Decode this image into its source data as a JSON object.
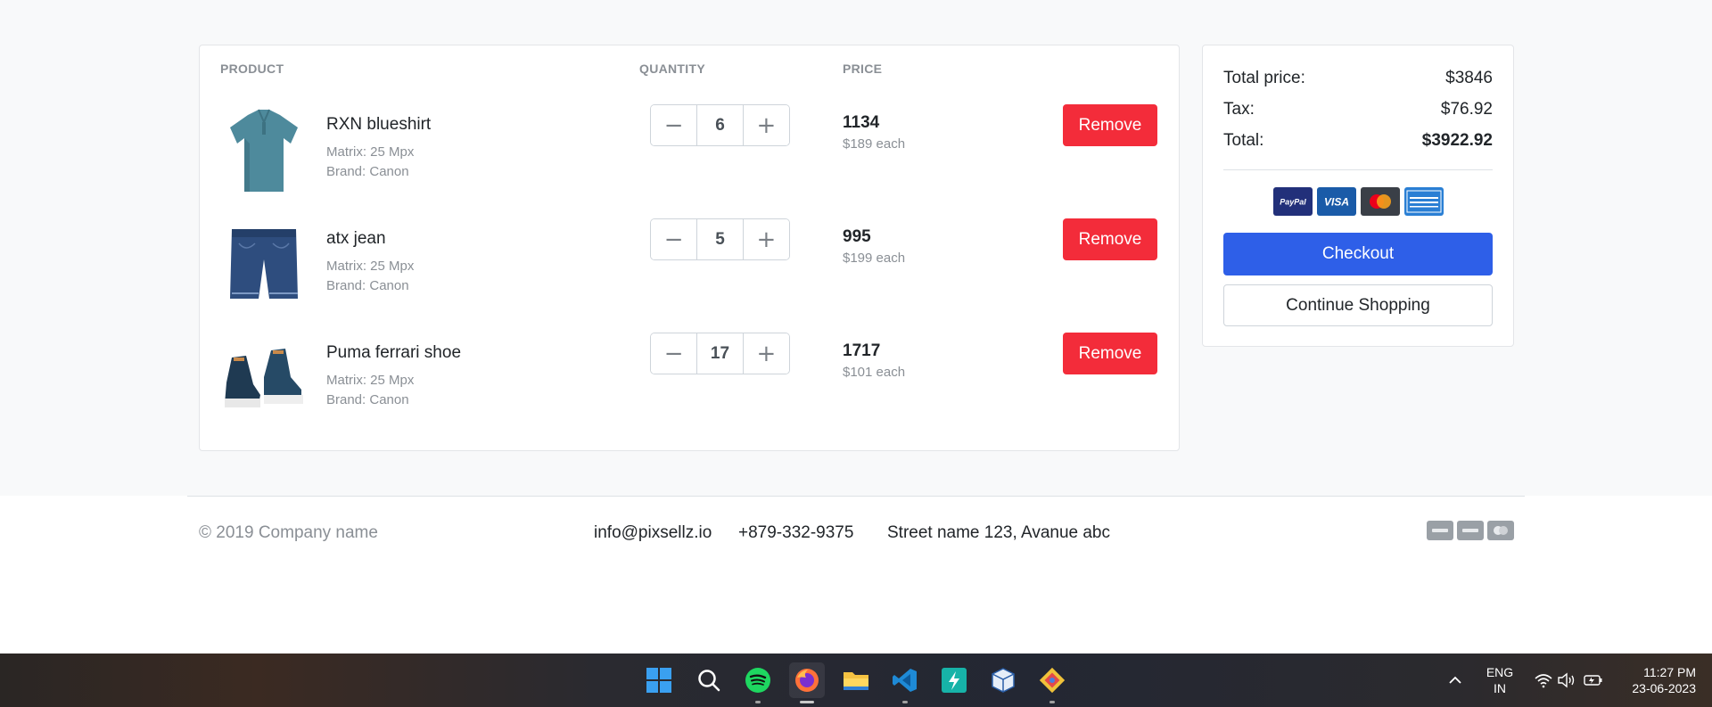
{
  "cart": {
    "headers": {
      "product": "PRODUCT",
      "quantity": "QUANTITY",
      "price": "PRICE"
    },
    "items": [
      {
        "name": "RXN blueshirt",
        "matrix": "Matrix: 25 Mpx",
        "brand": "Brand: Canon",
        "quantity": "6",
        "total": "1134",
        "each": "$189 each",
        "remove_label": "Remove",
        "minus": "−",
        "plus": "+"
      },
      {
        "name": "atx jean",
        "matrix": "Matrix: 25 Mpx",
        "brand": "Brand: Canon",
        "quantity": "5",
        "total": "995",
        "each": "$199 each",
        "remove_label": "Remove",
        "minus": "−",
        "plus": "+"
      },
      {
        "name": "Puma ferrari shoe",
        "matrix": "Matrix: 25 Mpx",
        "brand": "Brand: Canon",
        "quantity": "17",
        "total": "1717",
        "each": "$101 each",
        "remove_label": "Remove",
        "minus": "−",
        "plus": "+"
      }
    ]
  },
  "summary": {
    "total_price_label": "Total price:",
    "total_price": "$3846",
    "tax_label": "Tax:",
    "tax": "$76.92",
    "total_label": "Total:",
    "total": "$3922.92",
    "payment_icons": [
      "paypal-icon",
      "visa-icon",
      "mastercard-icon",
      "amex-icon"
    ],
    "checkout_label": "Checkout",
    "continue_label": "Continue Shopping"
  },
  "footer": {
    "copyright": "© 2019 Company name",
    "email": "info@pixsellz.io",
    "phone": "+879-332-9375",
    "address": "Street name 123, Avanue abc"
  },
  "taskbar": {
    "apps": [
      "windows-start-icon",
      "search-icon",
      "spotify-icon",
      "firefox-icon",
      "file-explorer-icon",
      "vscode-icon",
      "app-icon",
      "virtualbox-icon",
      "git-icon"
    ],
    "language": "ENG",
    "region": "IN",
    "time": "11:27 PM",
    "date": "23-06-2023"
  },
  "colors": {
    "remove": "#f32c3a",
    "checkout": "#2e5fe8",
    "page_bg": "#f8f9fa"
  }
}
